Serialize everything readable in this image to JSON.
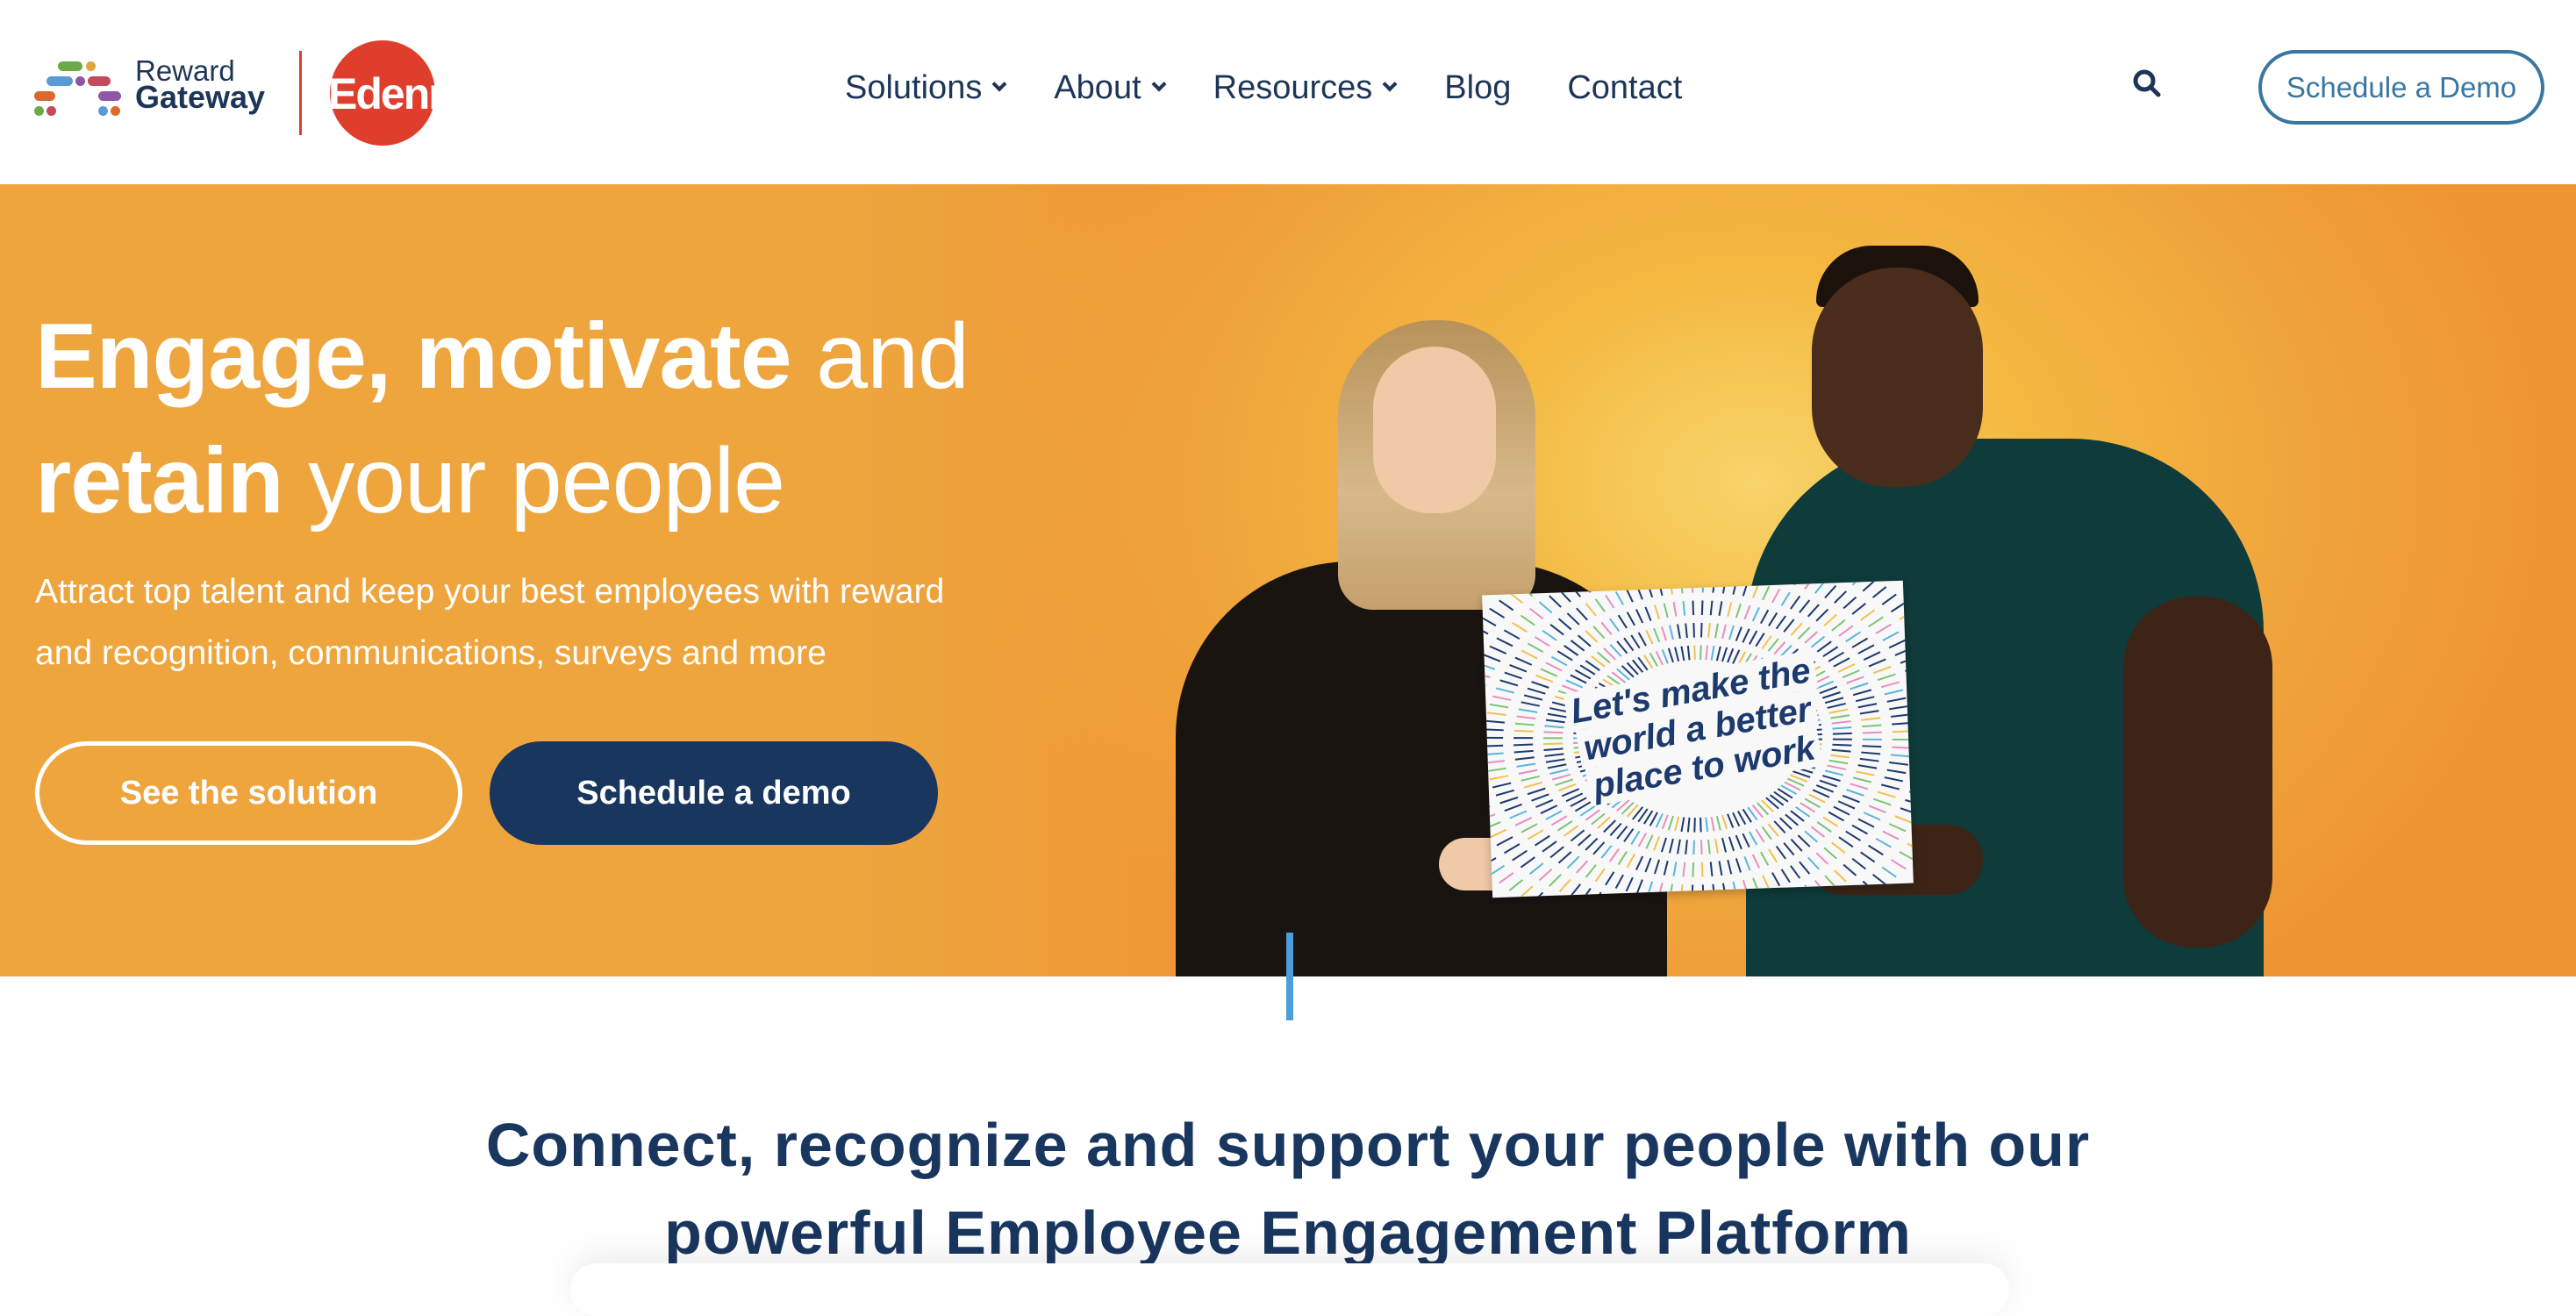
{
  "brand": {
    "reward_line1": "Reward",
    "reward_line2": "Gateway",
    "edenred_white": "Eden",
    "edenred_red": "red",
    "colors": {
      "navy": "#1d3557",
      "edenred": "#e03e2d",
      "accent_blue": "#3a77a0",
      "hero_orange": "#eea53e",
      "button_navy": "#19365f"
    }
  },
  "nav": {
    "items": [
      {
        "label": "Solutions",
        "has_dropdown": true
      },
      {
        "label": "About",
        "has_dropdown": true
      },
      {
        "label": "Resources",
        "has_dropdown": true
      },
      {
        "label": "Blog",
        "has_dropdown": false
      },
      {
        "label": "Contact",
        "has_dropdown": false
      }
    ],
    "search_icon": "search-icon",
    "cta_label": "Schedule a Demo"
  },
  "hero": {
    "heading_bold1": "Engage, motivate",
    "heading_light1": " and",
    "heading_bold2": "retain",
    "heading_light2": " your people",
    "subtitle_line1": "Attract top talent and keep your best employees with reward",
    "subtitle_line2": "and recognition, communications, surveys and more",
    "primary_button": "See the solution",
    "secondary_button": "Schedule a demo",
    "sign_line1": "Let's make the",
    "sign_line2": "world a better",
    "sign_line3": "place to work"
  },
  "section": {
    "heading_line1": "Connect, recognize and support your people with our",
    "heading_line2": "powerful Employee Engagement Platform"
  }
}
